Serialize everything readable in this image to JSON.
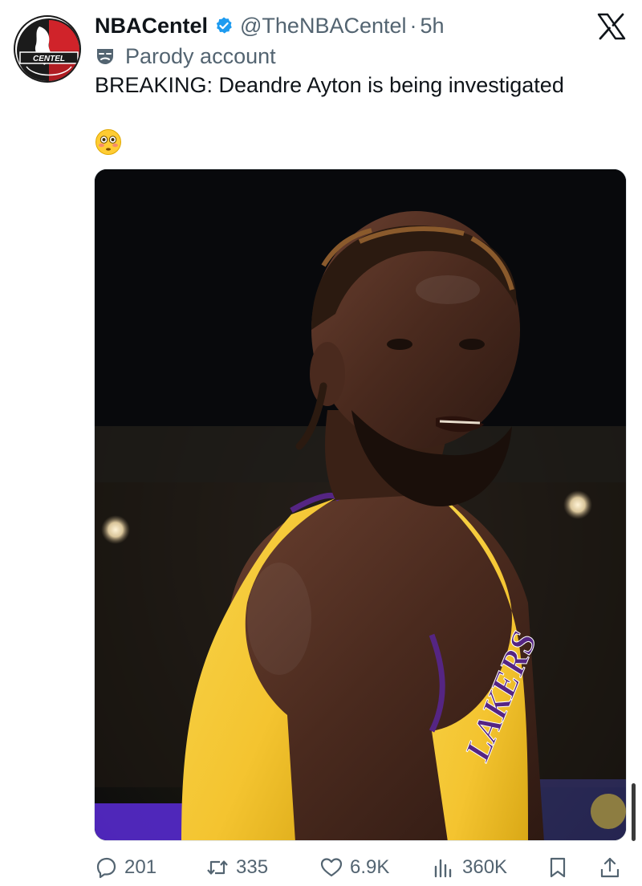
{
  "tweet": {
    "display_name": "NBACentel",
    "handle": "@TheNBACentel",
    "separator": "·",
    "time_ago": "5h",
    "account_label": "Parody account",
    "text": "BREAKING: Deandre Ayton is being investigated",
    "emoji": "😳",
    "avatar_text": "CENTEL",
    "media_jersey_text": "LAKERS"
  },
  "actions": {
    "replies": "201",
    "reposts": "335",
    "likes": "6.9K",
    "views": "360K"
  },
  "icons": {
    "verified": "verified-badge-icon",
    "x_logo": "x-logo-icon",
    "parody": "mask-icon",
    "reply": "reply-icon",
    "repost": "repost-icon",
    "like": "heart-icon",
    "views": "views-icon",
    "bookmark": "bookmark-icon",
    "share": "share-icon"
  },
  "colors": {
    "verified": "#1d9bf0",
    "text": "#0f1419",
    "secondary": "#536471",
    "jersey_gold": "#f4c430",
    "jersey_purple": "#552583"
  }
}
